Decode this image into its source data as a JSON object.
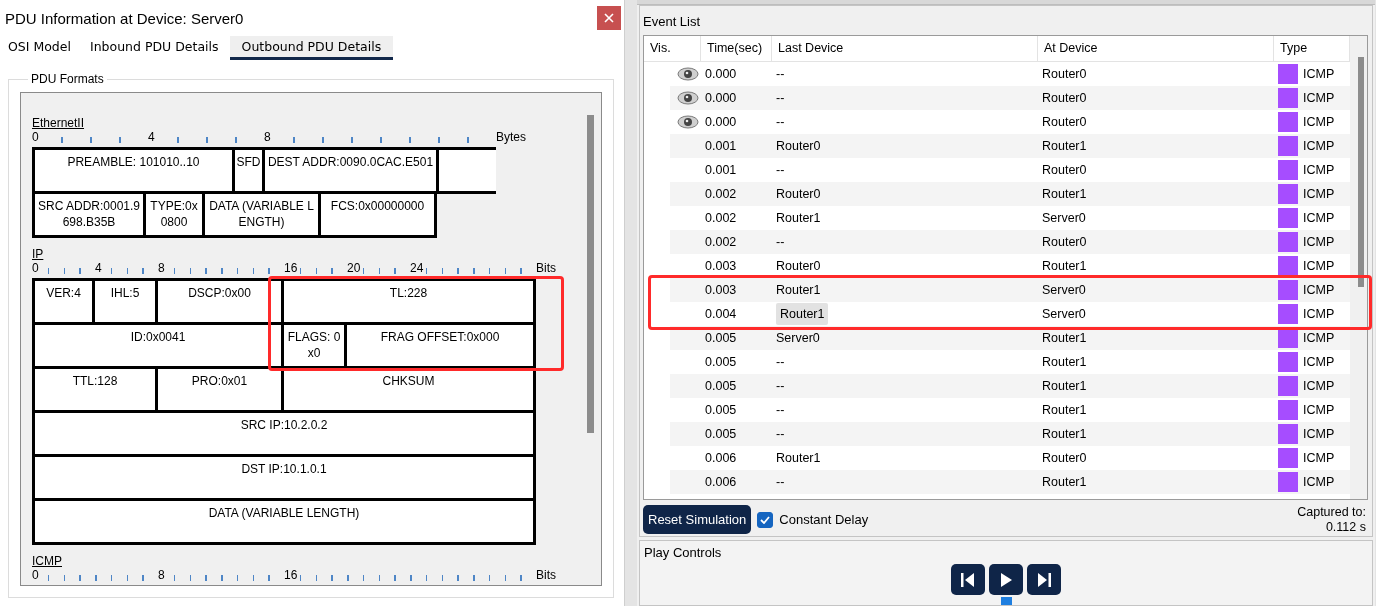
{
  "pdu_window": {
    "title": "PDU Information at Device: Server0",
    "tabs": [
      {
        "label": "OSI Model",
        "selected": false
      },
      {
        "label": "Inbound PDU Details",
        "selected": false
      },
      {
        "label": "Outbound PDU Details",
        "selected": true
      }
    ],
    "group_label": "PDU Formats",
    "sections": [
      {
        "name": "EthernetII",
        "ruler": {
          "unit": "Bytes",
          "marks": [
            {
              "kind": "label",
              "text": "0"
            },
            {
              "kind": "tick"
            },
            {
              "kind": "tick"
            },
            {
              "kind": "tick"
            },
            {
              "kind": "label",
              "text": "4"
            },
            {
              "kind": "tick"
            },
            {
              "kind": "tick"
            },
            {
              "kind": "tick"
            },
            {
              "kind": "label",
              "text": "8"
            },
            {
              "kind": "tick"
            },
            {
              "kind": "tick"
            },
            {
              "kind": "tick"
            },
            {
              "kind": "tick"
            },
            {
              "kind": "tick"
            },
            {
              "kind": "tick"
            },
            {
              "kind": "tick"
            }
          ]
        },
        "lines": [
          {
            "fields": [
              {
                "kind": "field",
                "text": "PREAMBLE: 101010..10"
              },
              {
                "kind": "field",
                "text": "SFD"
              },
              {
                "kind": "field",
                "text": "DEST ADDR:0090.0CAC.E501"
              },
              {
                "kind": "open"
              }
            ]
          },
          {
            "fields": [
              {
                "kind": "field",
                "text": "SRC ADDR:0001.9698.B35B"
              },
              {
                "kind": "field",
                "text": "TYPE:0x0800"
              },
              {
                "kind": "field",
                "text": "DATA (VARIABLE LENGTH)"
              },
              {
                "kind": "field",
                "text": "FCS:0x00000000"
              }
            ]
          }
        ]
      },
      {
        "name": "IP",
        "ruler": {
          "unit": "Bits",
          "marks": [
            {
              "kind": "label",
              "text": "0"
            },
            {
              "kind": "tick"
            },
            {
              "kind": "tick"
            },
            {
              "kind": "tick"
            },
            {
              "kind": "label",
              "text": "4"
            },
            {
              "kind": "tick"
            },
            {
              "kind": "tick"
            },
            {
              "kind": "tick"
            },
            {
              "kind": "label",
              "text": "8"
            },
            {
              "kind": "tick"
            },
            {
              "kind": "tick"
            },
            {
              "kind": "tick"
            },
            {
              "kind": "tick"
            },
            {
              "kind": "tick"
            },
            {
              "kind": "tick"
            },
            {
              "kind": "tick"
            },
            {
              "kind": "label",
              "text": "16"
            },
            {
              "kind": "tick"
            },
            {
              "kind": "tick"
            },
            {
              "kind": "tick"
            },
            {
              "kind": "label",
              "text": "20"
            },
            {
              "kind": "tick"
            },
            {
              "kind": "tick"
            },
            {
              "kind": "tick"
            },
            {
              "kind": "label",
              "text": "24"
            },
            {
              "kind": "tick"
            },
            {
              "kind": "tick"
            },
            {
              "kind": "tick"
            },
            {
              "kind": "tick"
            },
            {
              "kind": "tick"
            },
            {
              "kind": "tick"
            },
            {
              "kind": "tick"
            }
          ]
        },
        "lines": [
          {
            "fields": [
              {
                "kind": "field",
                "text": "VER:4"
              },
              {
                "kind": "field",
                "text": "IHL:5"
              },
              {
                "kind": "field",
                "text": "DSCP:0x00"
              },
              {
                "kind": "field",
                "text": "TL:228"
              }
            ]
          },
          {
            "fields": [
              {
                "kind": "field",
                "text": "ID:0x0041"
              },
              {
                "kind": "field",
                "text": "FLAGS: 0x0"
              },
              {
                "kind": "field",
                "text": "FRAG OFFSET:0x000"
              }
            ]
          },
          {
            "fields": [
              {
                "kind": "field",
                "text": "TTL:128"
              },
              {
                "kind": "field",
                "text": "PRO:0x01"
              },
              {
                "kind": "field",
                "text": "CHKSUM"
              }
            ]
          },
          {
            "fields": [
              {
                "kind": "field",
                "text": "SRC IP:10.2.0.2"
              }
            ]
          },
          {
            "fields": [
              {
                "kind": "field",
                "text": "DST IP:10.1.0.1"
              }
            ]
          },
          {
            "fields": [
              {
                "kind": "field",
                "text": "DATA (VARIABLE LENGTH)"
              }
            ]
          }
        ]
      },
      {
        "name": "ICMP",
        "ruler": {
          "unit": "Bits",
          "marks": [
            {
              "kind": "label",
              "text": "0"
            },
            {
              "kind": "tick"
            },
            {
              "kind": "tick"
            },
            {
              "kind": "tick"
            },
            {
              "kind": "tick"
            },
            {
              "kind": "tick"
            },
            {
              "kind": "tick"
            },
            {
              "kind": "tick"
            },
            {
              "kind": "label",
              "text": "8"
            },
            {
              "kind": "tick"
            },
            {
              "kind": "tick"
            },
            {
              "kind": "tick"
            },
            {
              "kind": "tick"
            },
            {
              "kind": "tick"
            },
            {
              "kind": "tick"
            },
            {
              "kind": "tick"
            },
            {
              "kind": "label",
              "text": "16"
            },
            {
              "kind": "tick"
            },
            {
              "kind": "tick"
            },
            {
              "kind": "tick"
            },
            {
              "kind": "tick"
            },
            {
              "kind": "tick"
            },
            {
              "kind": "tick"
            },
            {
              "kind": "tick"
            },
            {
              "kind": "tick"
            },
            {
              "kind": "tick"
            },
            {
              "kind": "tick"
            },
            {
              "kind": "tick"
            },
            {
              "kind": "tick"
            },
            {
              "kind": "tick"
            },
            {
              "kind": "tick"
            },
            {
              "kind": "tick"
            }
          ]
        }
      }
    ]
  },
  "simulation": {
    "event_list_label": "Event List",
    "columns": [
      "Vis.",
      "Time(sec)",
      "Last Device",
      "At Device",
      "Type"
    ],
    "events": [
      {
        "visible": true,
        "time": "0.000",
        "last_device": "--",
        "at_device": "Router0",
        "type": "ICMP",
        "color": "#a64dff",
        "selected": false
      },
      {
        "visible": true,
        "time": "0.000",
        "last_device": "--",
        "at_device": "Router0",
        "type": "ICMP",
        "color": "#a64dff",
        "selected": false
      },
      {
        "visible": true,
        "time": "0.000",
        "last_device": "--",
        "at_device": "Router0",
        "type": "ICMP",
        "color": "#a64dff",
        "selected": false
      },
      {
        "visible": false,
        "time": "0.001",
        "last_device": "Router0",
        "at_device": "Router1",
        "type": "ICMP",
        "color": "#a64dff",
        "selected": false
      },
      {
        "visible": false,
        "time": "0.001",
        "last_device": "--",
        "at_device": "Router0",
        "type": "ICMP",
        "color": "#a64dff",
        "selected": false
      },
      {
        "visible": false,
        "time": "0.002",
        "last_device": "Router0",
        "at_device": "Router1",
        "type": "ICMP",
        "color": "#a64dff",
        "selected": false
      },
      {
        "visible": false,
        "time": "0.002",
        "last_device": "Router1",
        "at_device": "Server0",
        "type": "ICMP",
        "color": "#a64dff",
        "selected": false
      },
      {
        "visible": false,
        "time": "0.002",
        "last_device": "--",
        "at_device": "Router0",
        "type": "ICMP",
        "color": "#a64dff",
        "selected": false
      },
      {
        "visible": false,
        "time": "0.003",
        "last_device": "Router0",
        "at_device": "Router1",
        "type": "ICMP",
        "color": "#a64dff",
        "selected": false
      },
      {
        "visible": false,
        "time": "0.003",
        "last_device": "Router1",
        "at_device": "Server0",
        "type": "ICMP",
        "color": "#a64dff",
        "selected": false
      },
      {
        "visible": false,
        "time": "0.004",
        "last_device": "Router1",
        "at_device": "Server0",
        "type": "ICMP",
        "color": "#a64dff",
        "selected": true
      },
      {
        "visible": false,
        "time": "0.005",
        "last_device": "Server0",
        "at_device": "Router1",
        "type": "ICMP",
        "color": "#a64dff",
        "selected": false
      },
      {
        "visible": false,
        "time": "0.005",
        "last_device": "--",
        "at_device": "Router1",
        "type": "ICMP",
        "color": "#a64dff",
        "selected": false
      },
      {
        "visible": false,
        "time": "0.005",
        "last_device": "--",
        "at_device": "Router1",
        "type": "ICMP",
        "color": "#a64dff",
        "selected": false
      },
      {
        "visible": false,
        "time": "0.005",
        "last_device": "--",
        "at_device": "Router1",
        "type": "ICMP",
        "color": "#a64dff",
        "selected": false
      },
      {
        "visible": false,
        "time": "0.005",
        "last_device": "--",
        "at_device": "Router1",
        "type": "ICMP",
        "color": "#a64dff",
        "selected": false
      },
      {
        "visible": false,
        "time": "0.006",
        "last_device": "Router1",
        "at_device": "Router0",
        "type": "ICMP",
        "color": "#a64dff",
        "selected": false
      },
      {
        "visible": false,
        "time": "0.006",
        "last_device": "--",
        "at_device": "Router1",
        "type": "ICMP",
        "color": "#a64dff",
        "selected": false
      }
    ],
    "reset_button": "Reset Simulation",
    "constant_delay": {
      "label": "Constant Delay",
      "checked": true
    },
    "captured_label": "Captured to:",
    "captured_value": "0.112 s",
    "play_controls_label": "Play Controls"
  }
}
